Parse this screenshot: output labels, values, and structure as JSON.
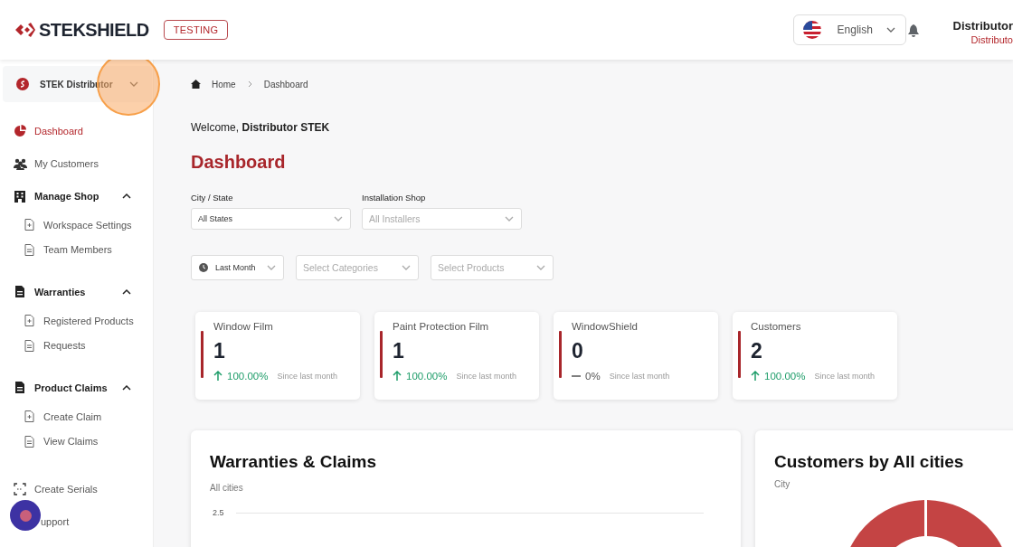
{
  "header": {
    "logo": "STEKSHIELD",
    "env_badge": "TESTING",
    "language": {
      "value": "English"
    },
    "user": {
      "name": "Distributor",
      "role": "Distributo"
    }
  },
  "sidebar": {
    "account": {
      "name": "STEK Distributor",
      "expanded": false
    },
    "items": [
      {
        "kind": "link",
        "label": "Dashboard",
        "selected": true
      },
      {
        "kind": "link",
        "label": "My Customers",
        "selected": false
      },
      {
        "kind": "group",
        "label": "Manage Shop",
        "expanded": true,
        "children": [
          {
            "label": "Workspace Settings",
            "selected": false
          },
          {
            "label": "Team Members",
            "selected": false
          }
        ]
      },
      {
        "kind": "group",
        "label": "Warranties",
        "expanded": true,
        "children": [
          {
            "label": "Registered Products",
            "selected": false
          },
          {
            "label": "Requests",
            "selected": false
          }
        ]
      },
      {
        "kind": "group",
        "label": "Product Claims",
        "expanded": true,
        "children": [
          {
            "label": "Create Claim",
            "selected": false
          },
          {
            "label": "View Claims",
            "selected": false
          }
        ]
      },
      {
        "kind": "link",
        "label": "Create Serials",
        "selected": false
      },
      {
        "kind": "link",
        "label": "upport",
        "selected": false
      }
    ]
  },
  "breadcrumb": [
    "Home",
    "Dashboard"
  ],
  "welcome": "Welcome, **Distributor STEK**",
  "page_title": "Dashboard",
  "filters": [
    {
      "label": "City / State",
      "value": "All States"
    },
    {
      "label": "Installation Shop",
      "placeholder": "All Installers"
    }
  ],
  "filters_2": [
    {
      "kind": "period",
      "value": "Last Month"
    },
    {
      "kind": "select",
      "placeholder": "Select Categories"
    },
    {
      "kind": "select",
      "placeholder": "Select Products"
    }
  ],
  "stats": [
    {
      "title": "Window Film",
      "value": "1",
      "kind": "up",
      "change": "100.00%",
      "note": "Since last month"
    },
    {
      "title": "Paint Protection Film",
      "value": "1",
      "kind": "up",
      "change": "100.00%",
      "note": "Since last month"
    },
    {
      "title": "WindowShield",
      "value": "0",
      "kind": "flat",
      "change": "0%",
      "note": "Since last month"
    },
    {
      "title": "Customers",
      "value": "2",
      "kind": "up",
      "change": "100.00%",
      "note": "Since last month"
    }
  ],
  "panels": [
    {
      "kind": "line",
      "title": "Warranties & Claims",
      "subtitle": "All cities",
      "y_tick": "2.5"
    },
    {
      "kind": "donut",
      "title": "Customers by All cities",
      "subtitle": "City"
    }
  ]
}
